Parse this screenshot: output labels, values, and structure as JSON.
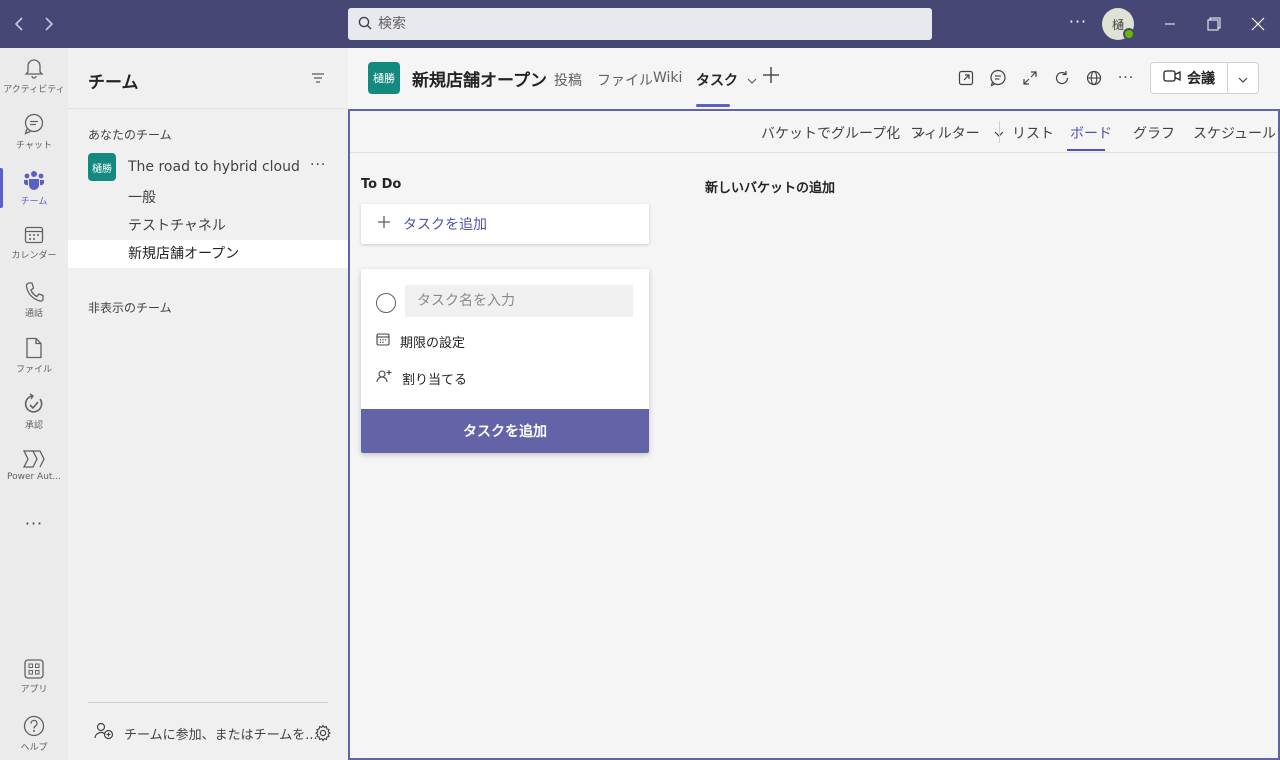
{
  "colors": {
    "titlebar": "#464775",
    "accent": "#5b5fc7",
    "teal_avatar": "#13897f",
    "button_primary": "#6264a7",
    "presence": "#6bb700"
  },
  "titlebar": {
    "search_placeholder": "検索",
    "more_label": "···",
    "avatar_initial": "樋",
    "icons": {
      "back": "chevron-left-icon",
      "forward": "chevron-right-icon",
      "search": "search-icon",
      "minimize": "minimize-icon",
      "restore": "restore-icon",
      "close": "close-icon"
    }
  },
  "rail": {
    "items": [
      {
        "label": "アクティビティ",
        "icon": "bell-icon"
      },
      {
        "label": "チャット",
        "icon": "chat-icon"
      },
      {
        "label": "チーム",
        "icon": "teams-icon",
        "active": true
      },
      {
        "label": "カレンダー",
        "icon": "calendar-icon"
      },
      {
        "label": "通話",
        "icon": "phone-icon"
      },
      {
        "label": "ファイル",
        "icon": "file-icon"
      },
      {
        "label": "承認",
        "icon": "approval-icon"
      },
      {
        "label": "Power Aut...",
        "icon": "power-automate-icon"
      },
      {
        "label": "···",
        "icon": "more-icon"
      }
    ],
    "bottom": [
      {
        "label": "アプリ",
        "icon": "apps-icon"
      },
      {
        "label": "ヘルプ",
        "icon": "help-icon"
      }
    ]
  },
  "teams_panel": {
    "title": "チーム",
    "your_teams_label": "あなたのチーム",
    "hidden_teams_label": "非表示のチーム",
    "team": {
      "avatar": "樋勝",
      "name": "The road to hybrid cloud",
      "more": "···"
    },
    "channels": [
      "一般",
      "テストチャネル",
      "新規店舗オープン"
    ],
    "active_channel_index": 2,
    "join_label": "チームに参加、またはチームを..."
  },
  "channel_header": {
    "avatar": "樋勝",
    "title": "新規店舗オープン",
    "tabs": [
      "投稿",
      "ファイル",
      "Wiki",
      "タスク"
    ],
    "active_tab": "タスク",
    "meet_label": "会議"
  },
  "planner": {
    "toolbar": {
      "group_by": "バケットでグループ化",
      "filter": "フィルター",
      "views": [
        "リスト",
        "ボード",
        "グラフ",
        "スケジュール"
      ],
      "active_view": "ボード"
    },
    "bucket": {
      "name": "To Do",
      "add_task": "タスクを追加"
    },
    "new_bucket": "新しいバケットの追加",
    "task_card": {
      "name_placeholder": "タスク名を入力",
      "due_date": "期限の設定",
      "assign": "割り当てる",
      "submit": "タスクを追加"
    }
  }
}
